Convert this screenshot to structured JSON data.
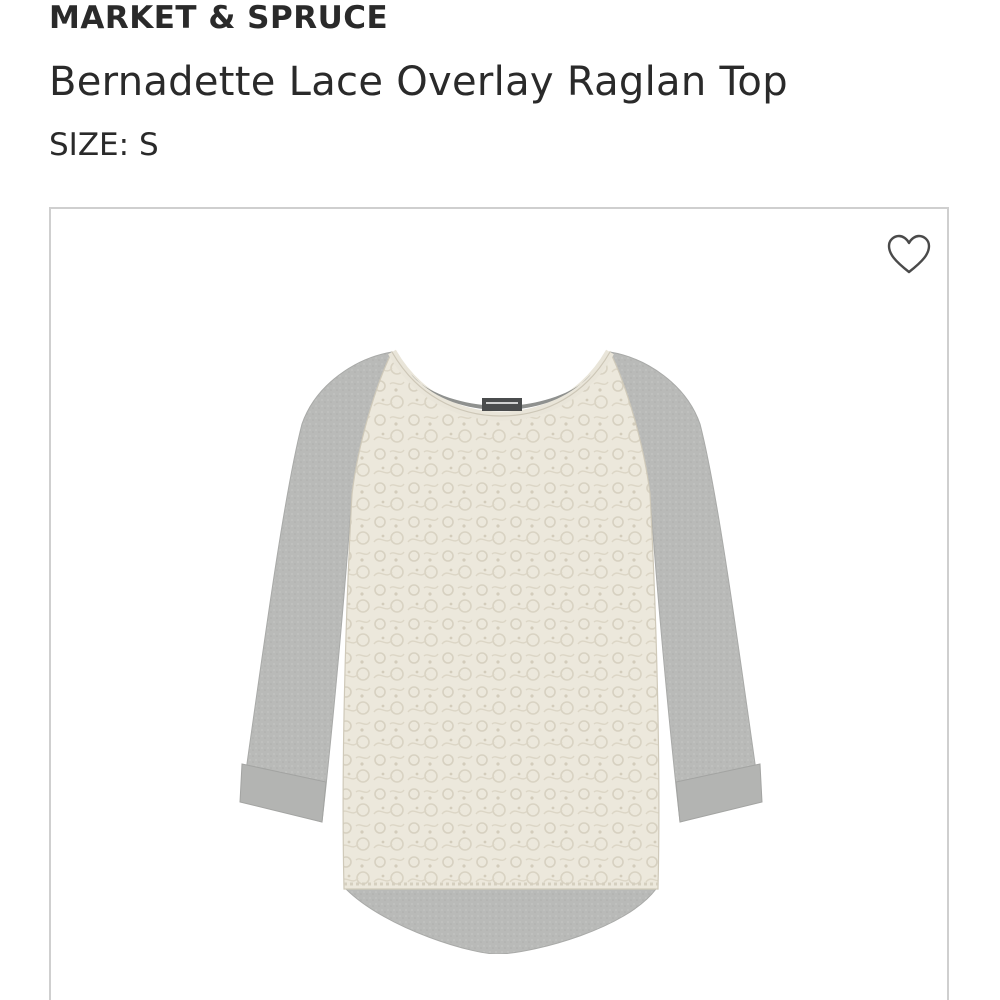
{
  "product": {
    "brand": "MARKET & SPRUCE",
    "title": "Bernadette Lace Overlay Raglan Top",
    "size_label": "SIZE: S"
  },
  "image": {
    "favorite_icon": "heart-outline-icon",
    "colors": {
      "sleeve_gray": "#b8b9b7",
      "lace_cream": "#ece8dc",
      "border": "#cfcfcf"
    }
  }
}
